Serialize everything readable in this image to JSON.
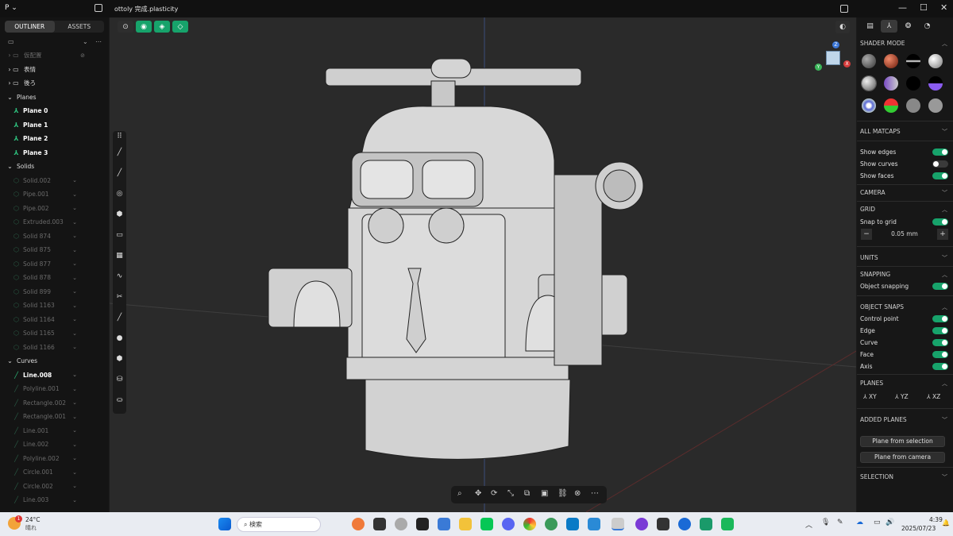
{
  "window": {
    "title": "ottoly 完成.plasticity",
    "logo": "P ⌄"
  },
  "outliner": {
    "tab_outliner": "OUTLINER",
    "tab_assets": "ASSETS",
    "rows": [
      {
        "label": "仮配置",
        "type": "folder",
        "dim": true
      },
      {
        "label": "表情",
        "type": "folder"
      },
      {
        "label": "後ろ",
        "type": "folder"
      },
      {
        "label": "Planes",
        "type": "group"
      },
      {
        "label": "Plane 0",
        "type": "plane",
        "bold": true
      },
      {
        "label": "Plane 1",
        "type": "plane",
        "bold": true
      },
      {
        "label": "Plane 2",
        "type": "plane",
        "bold": true
      },
      {
        "label": "Plane 3",
        "type": "plane",
        "bold": true
      },
      {
        "label": "Solids",
        "type": "group"
      },
      {
        "label": "Solid.002",
        "type": "solid",
        "dim": true
      },
      {
        "label": "Pipe.001",
        "type": "solid",
        "dim": true
      },
      {
        "label": "Pipe.002",
        "type": "solid",
        "dim": true
      },
      {
        "label": "Extruded.003",
        "type": "solid",
        "dim": true
      },
      {
        "label": "Solid 874",
        "type": "solid",
        "dim": true
      },
      {
        "label": "Solid 875",
        "type": "solid",
        "dim": true
      },
      {
        "label": "Solid 877",
        "type": "solid",
        "dim": true
      },
      {
        "label": "Solid 878",
        "type": "solid",
        "dim": true
      },
      {
        "label": "Solid 899",
        "type": "solid",
        "dim": true
      },
      {
        "label": "Solid 1163",
        "type": "solid",
        "dim": true
      },
      {
        "label": "Solid 1164",
        "type": "solid",
        "dim": true
      },
      {
        "label": "Solid 1165",
        "type": "solid",
        "dim": true
      },
      {
        "label": "Solid 1166",
        "type": "solid",
        "dim": true
      },
      {
        "label": "Curves",
        "type": "group"
      },
      {
        "label": "Line.008",
        "type": "curve",
        "bold": true
      },
      {
        "label": "Polyline.001",
        "type": "curve",
        "dim": true
      },
      {
        "label": "Rectangle.002",
        "type": "curve",
        "dim": true
      },
      {
        "label": "Rectangle.001",
        "type": "curve",
        "dim": true
      },
      {
        "label": "Line.001",
        "type": "curve",
        "dim": true
      },
      {
        "label": "Line.002",
        "type": "curve",
        "dim": true
      },
      {
        "label": "Polyline.002",
        "type": "curve",
        "dim": true
      },
      {
        "label": "Circle.001",
        "type": "curve",
        "dim": true
      },
      {
        "label": "Circle.002",
        "type": "curve",
        "dim": true
      },
      {
        "label": "Line.003",
        "type": "curve",
        "dim": true
      }
    ]
  },
  "panel": {
    "shader_mode": "SHADER MODE",
    "all_matcaps": "ALL MATCAPS",
    "show_edges": "Show edges",
    "show_curves": "Show curves",
    "show_faces": "Show faces",
    "camera": "CAMERA",
    "grid": "GRID",
    "snap_to_grid": "Snap to grid",
    "grid_value": "0.05 mm",
    "units": "UNITS",
    "snapping": "SNAPPING",
    "object_snapping": "Object snapping",
    "object_snaps": "OBJECT SNAPS",
    "control_point": "Control point",
    "edge": "Edge",
    "curve": "Curve",
    "face": "Face",
    "axis": "Axis",
    "planes": "PLANES",
    "xy": "XY",
    "yz": "YZ",
    "xz": "XZ",
    "added_planes": "ADDED PLANES",
    "plane_from_selection": "Plane from selection",
    "plane_from_camera": "Plane from camera",
    "selection": "SELECTION",
    "toggles": {
      "show_edges": true,
      "show_curves": false,
      "show_faces": true,
      "snap_to_grid": true,
      "object_snapping": true,
      "control_point": true,
      "edge": true,
      "curve": true,
      "face": true,
      "axis": true
    }
  },
  "gizmo": {
    "x": "X",
    "y": "Y",
    "z": "Z"
  },
  "taskbar": {
    "weather_temp": "24°C",
    "weather_text": "晴れ",
    "weather_badge": "1",
    "search": "検索",
    "time": "4:39",
    "date": "2025/07/23"
  },
  "colors": {
    "accent": "#17a36b",
    "viewport": "#2a2a2a"
  }
}
